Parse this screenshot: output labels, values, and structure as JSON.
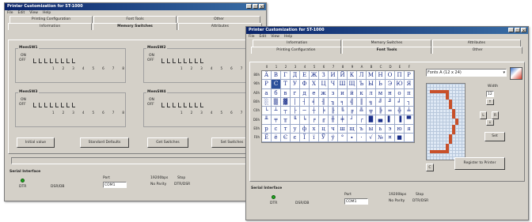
{
  "window_back": {
    "title": "Printer Customization for ST-1000",
    "menu": [
      "File",
      "Edit",
      "View",
      "Help"
    ],
    "tabs_top": [
      "Printing Configuration",
      "Font Tools",
      "Other"
    ],
    "tabs_bottom": [
      "Information",
      "Memory Switches",
      "Attributes"
    ],
    "groups": [
      {
        "title": "MemSW1",
        "on": "ON",
        "off": "OFF",
        "numbers": "1 2 3 4 5 6 7 8"
      },
      {
        "title": "MemSW2",
        "on": "ON",
        "off": "OFF",
        "numbers": "1 2 3 4 5 6 7 8"
      },
      {
        "title": "MemSW3",
        "on": "ON",
        "off": "OFF",
        "numbers": "1 2 3 4 5 6 7 8"
      },
      {
        "title": "MemSW4",
        "on": "ON",
        "off": "OFF",
        "numbers": "1 2 3 4 5 6 7 8"
      }
    ],
    "buttons": [
      "Initial value",
      "Standard Defaults",
      "Get Switches",
      "Set Switches"
    ],
    "serial": {
      "title": "Serial Interface",
      "led_label": "DTR",
      "dsr": "DSR/DB",
      "port_label": "Port",
      "port_value": "COM1",
      "baud": "19200bps",
      "parity": "No Parity",
      "stop": "Stop",
      "flow": "DTR/DSR"
    }
  },
  "window_front": {
    "title": "Printer Customization for ST-1000",
    "menu": [
      "File",
      "Edit",
      "View",
      "Help"
    ],
    "tabs_top": [
      "Information",
      "Memory Switches",
      "Attributes"
    ],
    "tabs_bottom": [
      "Printing Configuration",
      "Font Tools",
      "Other"
    ],
    "col_headers": [
      "0",
      "1",
      "2",
      "3",
      "4",
      "5",
      "6",
      "7",
      "8",
      "9",
      "A",
      "B",
      "C",
      "D",
      "E",
      "F"
    ],
    "row_headers": [
      "80h",
      "90h",
      "A0h",
      "B0h",
      "C0h",
      "D0h",
      "E0h",
      "F0h"
    ],
    "rows": [
      [
        "Ä",
        "B",
        "Г",
        "Д",
        "Е",
        "Ж",
        "З",
        "И",
        "Й",
        "К",
        "Л",
        "М",
        "Н",
        "О",
        "П",
        "Р"
      ],
      [
        "Р",
        "С",
        "Т",
        "У",
        "Ф",
        "Х",
        "Ц",
        "Ч",
        "Ш",
        "Щ",
        "Ъ",
        "Ы",
        "Ь",
        "Э",
        "Ю",
        "Я"
      ],
      [
        "а",
        "б",
        "в",
        "г",
        "д",
        "е",
        "ж",
        "з",
        "и",
        "й",
        "к",
        "л",
        "м",
        "н",
        "о",
        "п"
      ],
      [
        "░",
        "▒",
        "▓",
        "│",
        "┤",
        "╡",
        "╢",
        "╖",
        "╕",
        "╣",
        "║",
        "╗",
        "╝",
        "╜",
        "╛",
        "┐"
      ],
      [
        "└",
        "┴",
        "┬",
        "├",
        "─",
        "┼",
        "╞",
        "╟",
        "╚",
        "╔",
        "╩",
        "╦",
        "╠",
        "═",
        "╬",
        "╧"
      ],
      [
        "╨",
        "╤",
        "╥",
        "╙",
        "╘",
        "╒",
        "╓",
        "╫",
        "╪",
        "┘",
        "┌",
        "█",
        "▄",
        "▌",
        "▐",
        "▀"
      ],
      [
        "р",
        "с",
        "т",
        "у",
        "ф",
        "х",
        "ц",
        "ч",
        "ш",
        "щ",
        "ъ",
        "ы",
        "ь",
        "э",
        "ю",
        "я"
      ],
      [
        "Ё",
        "ё",
        "Є",
        "є",
        "Ї",
        "ї",
        "Ў",
        "ў",
        "°",
        "∙",
        "·",
        "√",
        "№",
        "¤",
        "■",
        " "
      ]
    ],
    "font_select": "Fonts A (12 x 24)",
    "width_label": "Width",
    "width_value": "12",
    "nav": {
      "up": "↑",
      "left": "L",
      "right": "R",
      "down": "↓"
    },
    "set_button": "Set",
    "clear_button": "C",
    "register_button": "Register to Printer",
    "serial": {
      "title": "Serial Interface",
      "led_label": "DTR",
      "dsr": "DSR/DB",
      "port_label": "Port",
      "port_value": "COM1",
      "baud": "19200bps",
      "parity": "No Parity",
      "stop": "Stop",
      "flow": "DTR/DSR"
    }
  },
  "colors": {
    "title_start": "#0a246a",
    "title_end": "#3a6ea5",
    "grid_text": "#1a2f8a",
    "glyph_pixels": "#c8502a",
    "led": "#1fa81f"
  }
}
